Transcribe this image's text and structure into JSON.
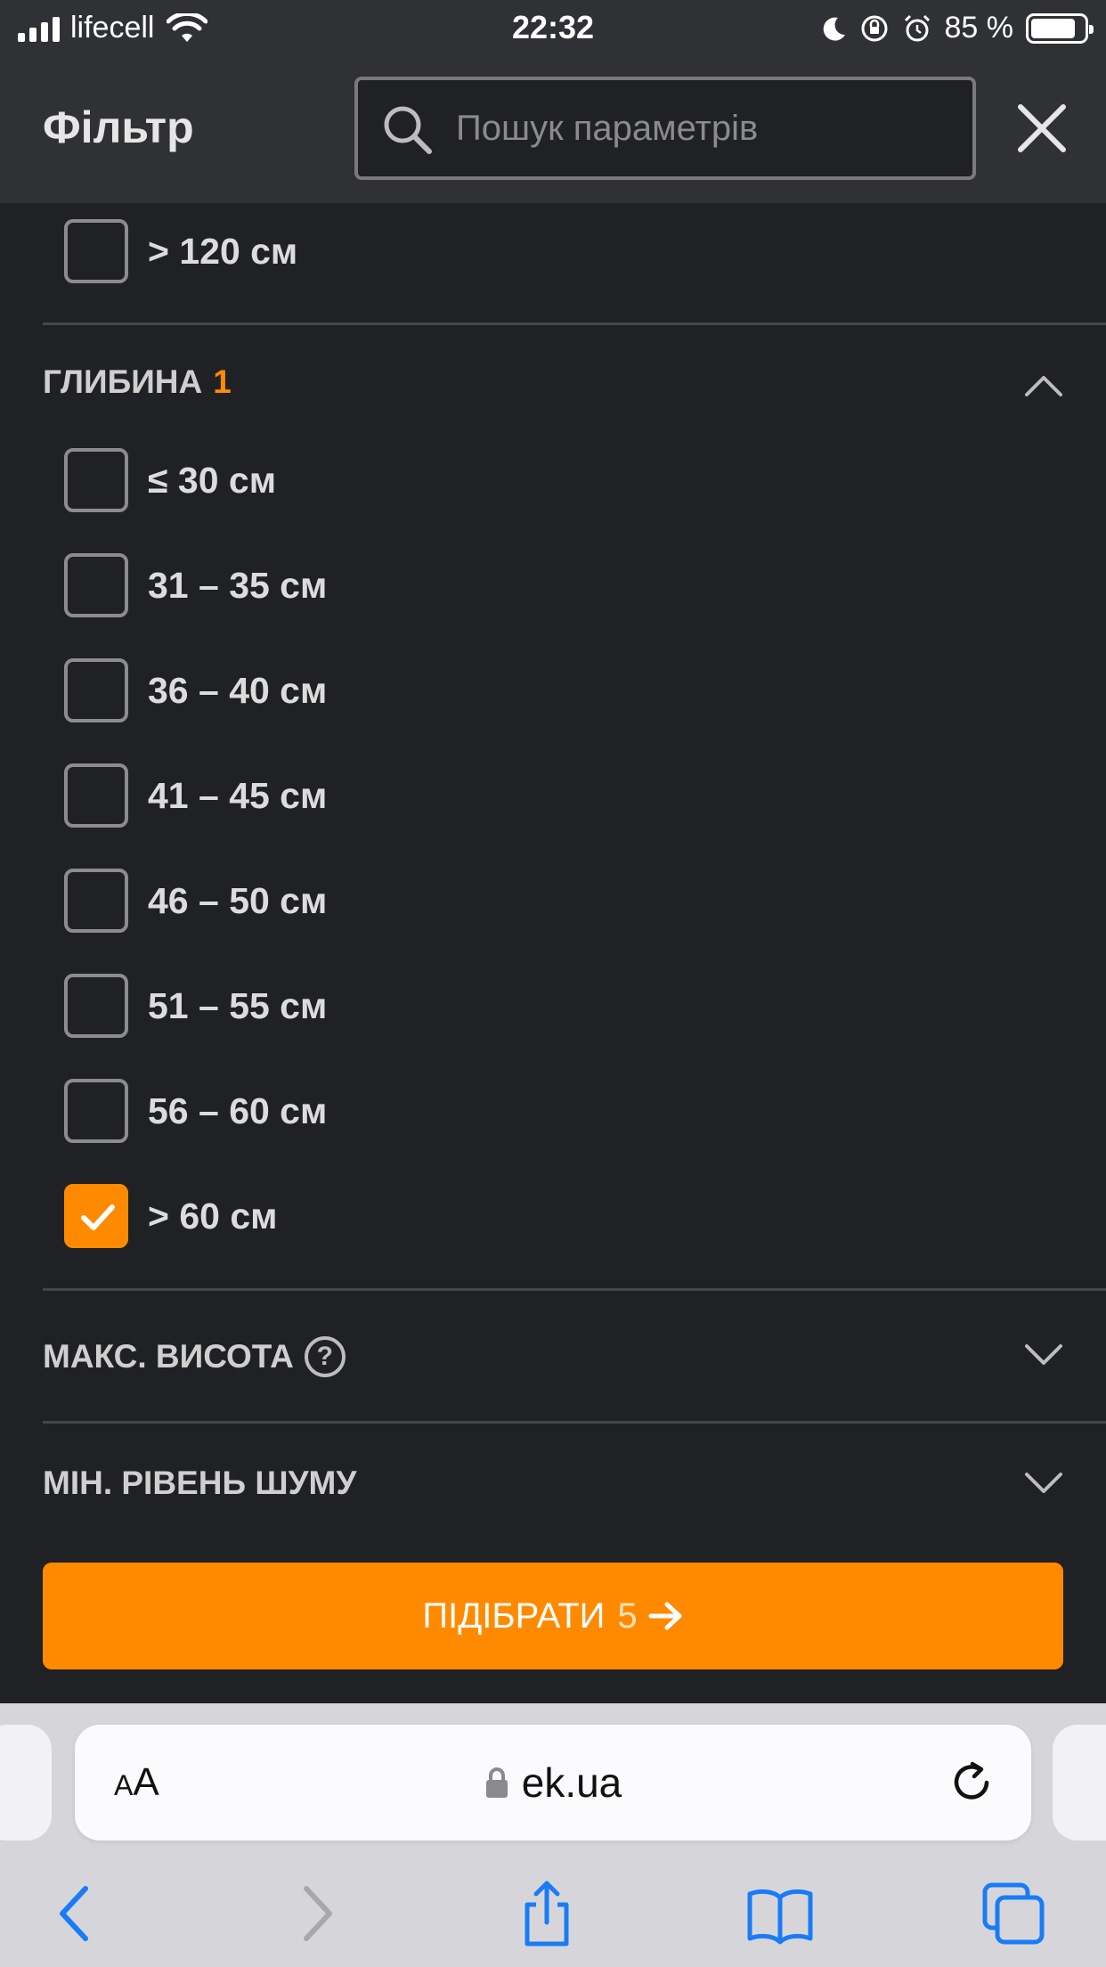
{
  "status_bar": {
    "carrier": "lifecell",
    "time": "22:32",
    "battery_percent": "85 %",
    "battery_level": 0.85
  },
  "header": {
    "title": "Фільтр",
    "search_placeholder": "Пошук параметрів"
  },
  "width_section": {
    "items": [
      {
        "label": "> 120 см",
        "checked": false
      }
    ]
  },
  "depth_section": {
    "title": "ГЛИБИНА",
    "count": "1",
    "expanded": true,
    "items": [
      {
        "label": "≤ 30 см",
        "checked": false
      },
      {
        "label": "31 – 35 см",
        "checked": false
      },
      {
        "label": "36 – 40 см",
        "checked": false
      },
      {
        "label": "41 – 45 см",
        "checked": false
      },
      {
        "label": "46 – 50 см",
        "checked": false
      },
      {
        "label": "51 – 55 см",
        "checked": false
      },
      {
        "label": "56 – 60 см",
        "checked": false
      },
      {
        "label": "> 60 см",
        "checked": true
      }
    ]
  },
  "max_height_section": {
    "title": "МАКС. ВИСОТА",
    "help": "?",
    "expanded": false
  },
  "noise_section": {
    "title": "МІН. РІВЕНЬ ШУМУ",
    "expanded": false
  },
  "cta": {
    "label": "ПІДІБРАТИ",
    "count": "5"
  },
  "browser": {
    "aa_small": "A",
    "aa_large": "A",
    "url": "ek.ua"
  },
  "colors": {
    "accent": "#ff8a00",
    "background": "#202125",
    "header_bg": "#303134",
    "safari_blue": "#1a7cf5"
  }
}
